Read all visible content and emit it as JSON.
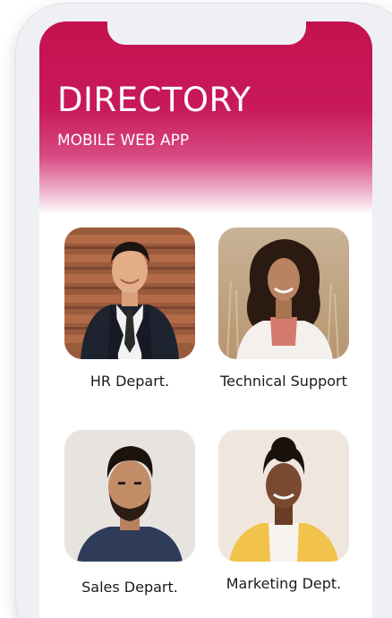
{
  "header": {
    "title": "DIRECTORY",
    "subtitle": "MOBILE WEB APP",
    "brand_color": "#c4124e"
  },
  "departments": [
    {
      "label": "HR Depart.",
      "icon": "man-in-suit-portrait"
    },
    {
      "label": "Technical Support",
      "icon": "woman-curly-hair-portrait"
    },
    {
      "label": "Sales Depart.",
      "icon": "bearded-man-portrait"
    },
    {
      "label": "Marketing Dept.",
      "icon": "woman-yellow-jacket-portrait"
    }
  ]
}
